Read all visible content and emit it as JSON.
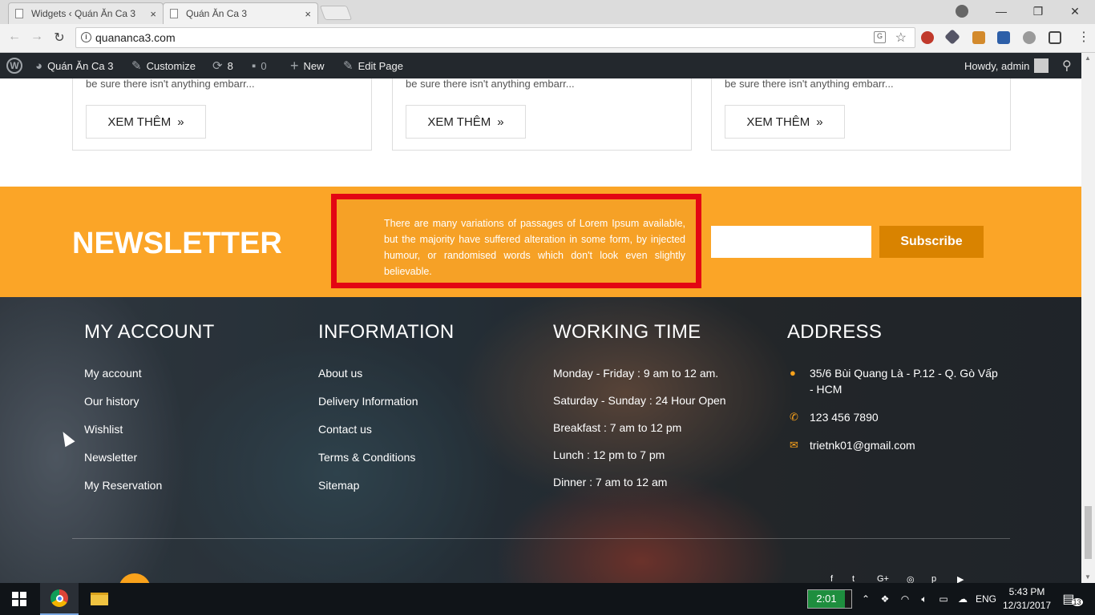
{
  "browser": {
    "tabs": [
      {
        "title": "Widgets ‹ Quán Ăn Ca 3",
        "close": "×"
      },
      {
        "title": "Quán Ăn Ca 3",
        "close": "×"
      }
    ],
    "url": "quananca3.com",
    "window_controls": {
      "minimize": "—",
      "maximize": "❐",
      "close": "✕"
    }
  },
  "wp_admin_bar": {
    "site_name": "Quán Ăn Ca 3",
    "customize": "Customize",
    "updates_count": "8",
    "comments_count": "0",
    "new": "New",
    "edit_page": "Edit Page",
    "howdy": "Howdy, admin"
  },
  "cards": [
    {
      "excerpt": "be sure there isn't anything embarr...",
      "button": "XEM THÊM",
      "chevron": "»"
    },
    {
      "excerpt": "be sure there isn't anything embarr...",
      "button": "XEM THÊM",
      "chevron": "»"
    },
    {
      "excerpt": "be sure there isn't anything embarr...",
      "button": "XEM THÊM",
      "chevron": "»"
    }
  ],
  "newsletter": {
    "title": "NEWSLETTER",
    "text": "There are many variations of passages of Lorem Ipsum available, but the majority have suffered alteration in some form, by injected humour, or randomised words which don't look even slightly believable.",
    "subscribe": "Subscribe",
    "accent": "#fba527",
    "highlight_border": "#e30613"
  },
  "footer": {
    "my_account": {
      "title": "MY ACCOUNT",
      "items": [
        "My account",
        "Our history",
        "Wishlist",
        "Newsletter",
        "My Reservation"
      ]
    },
    "information": {
      "title": "INFORMATION",
      "items": [
        "About us",
        "Delivery Information",
        "Contact us",
        "Terms & Conditions",
        "Sitemap"
      ]
    },
    "working_time": {
      "title": "WORKING TIME",
      "items": [
        "Monday - Friday : 9 am to 12 am.",
        "Saturday - Sunday : 24 Hour Open",
        "Breakfast : 7 am to 12 pm",
        "Lunch : 12 pm to 7 pm",
        "Dinner : 7 am to 12 am"
      ]
    },
    "address": {
      "title": "ADDRESS",
      "street": "35/6 Bùi Quang Là - P.12 - Q. Gò Vấp - HCM",
      "phone": "123 456 7890",
      "email": "trietnk01@gmail.com",
      "icon_color": "#f9a21b"
    }
  },
  "taskbar": {
    "timer": "2:01",
    "language": "ENG",
    "time": "5:43 PM",
    "date": "12/31/2017",
    "notifications": "13"
  }
}
